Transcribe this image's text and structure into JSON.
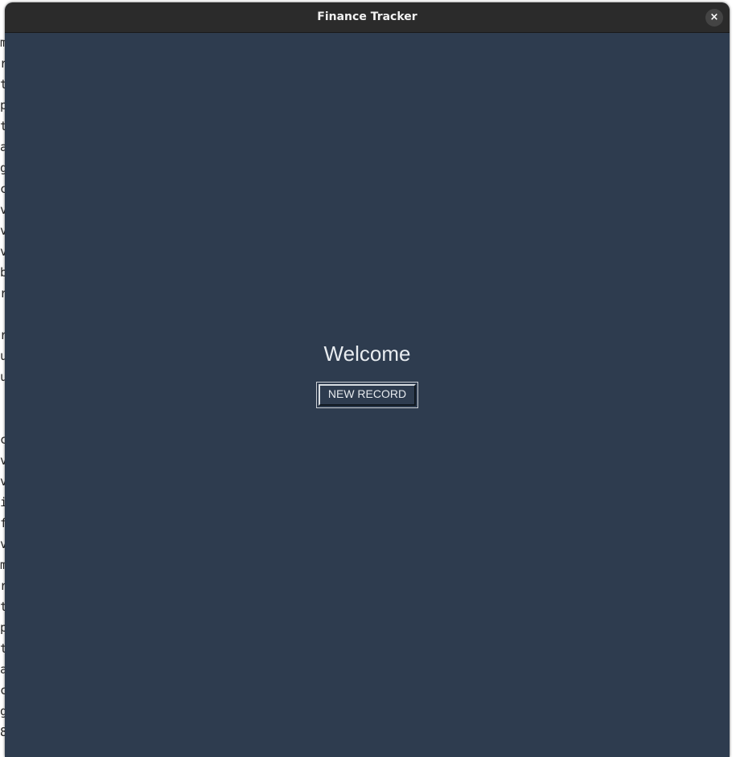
{
  "background_terminal": {
    "lines": [
      "m",
      "r",
      "t",
      "p",
      "t",
      "a",
      "g",
      "c",
      "v",
      "v",
      "v",
      "b",
      "r",
      "",
      "r",
      "u",
      "u",
      "",
      "",
      "c",
      "v",
      "v",
      "i",
      "f",
      "v",
      "m",
      "r",
      "t",
      "p",
      "t",
      "a",
      "c",
      "g",
      "8"
    ]
  },
  "window": {
    "title": "Finance Tracker",
    "close_icon": "×"
  },
  "main": {
    "heading": "Welcome",
    "new_record_label": "NEW RECORD"
  },
  "colors": {
    "window_bg": "#2e3c4f",
    "titlebar_bg": "#2b2b2b",
    "text": "#e8ecf0"
  }
}
